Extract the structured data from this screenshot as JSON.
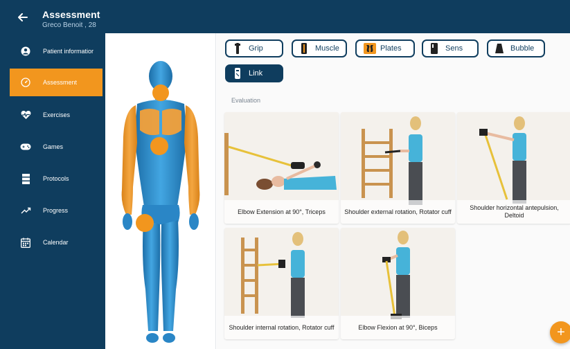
{
  "header": {
    "title": "Assessment",
    "subtitle": "Greco Benoit , 28",
    "back_icon": "arrow-left-icon"
  },
  "sidebar": {
    "items": [
      {
        "label": "Patient informatior",
        "icon": "person-circle-icon"
      },
      {
        "label": "Assessment",
        "icon": "gauge-icon",
        "active": true
      },
      {
        "label": "Exercises",
        "icon": "heart-pulse-icon"
      },
      {
        "label": "Games",
        "icon": "gamepad-icon"
      },
      {
        "label": "Protocols",
        "icon": "stack-icon"
      },
      {
        "label": "Progress",
        "icon": "trend-up-icon"
      },
      {
        "label": "Calendar",
        "icon": "calendar-icon"
      }
    ]
  },
  "devices": [
    {
      "label": "Grip",
      "icon": "grip-device-icon"
    },
    {
      "label": "Muscle",
      "icon": "muscle-device-icon"
    },
    {
      "label": "Plates",
      "icon": "plates-device-icon"
    },
    {
      "label": "Sens",
      "icon": "sens-device-icon"
    },
    {
      "label": "Bubble",
      "icon": "bubble-device-icon"
    },
    {
      "label": "Link",
      "icon": "link-device-icon",
      "selected": true
    }
  ],
  "evaluation": {
    "label": "Evaluation",
    "cards": [
      {
        "caption": "Elbow Extension at 90°, Triceps"
      },
      {
        "caption": "Shoulder external rotation, Rotator cuff"
      },
      {
        "caption": "Shoulder horizontal antepulsion, Deltoid"
      },
      {
        "caption": "Shoulder internal rotation, Rotator cuff"
      },
      {
        "caption": "Elbow Flexion at 90°, Biceps"
      }
    ]
  },
  "fab": {
    "label": "+",
    "icon": "add-icon"
  },
  "colors": {
    "primary": "#0f3d5e",
    "accent": "#f2961e",
    "body_blue": "#2f8fd3"
  }
}
